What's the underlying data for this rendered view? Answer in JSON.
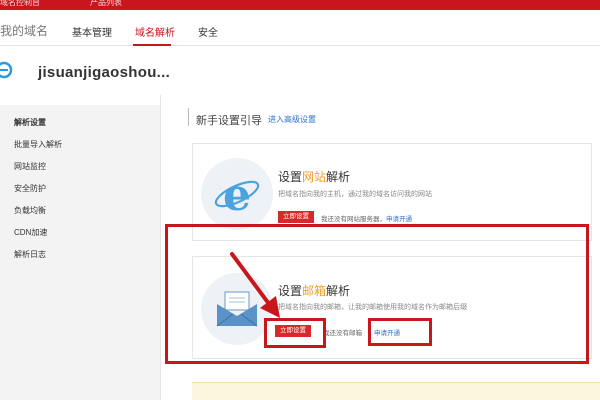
{
  "topbar": {
    "crumb_left": "域名控制台",
    "crumb_right": "产品列表"
  },
  "nav": {
    "title": "我的域名",
    "tabs": [
      {
        "label": "基本管理"
      },
      {
        "label": "域名解析"
      },
      {
        "label": "安全"
      }
    ],
    "active_tab": 1
  },
  "domain": {
    "name": "jisuanjigaoshou..."
  },
  "sidebar": {
    "items": [
      {
        "label": "解析设置"
      },
      {
        "label": "批量导入解析"
      },
      {
        "label": "网站监控"
      },
      {
        "label": "安全防护"
      },
      {
        "label": "负载均衡"
      },
      {
        "label": "CDN加速"
      },
      {
        "label": "解析日志"
      }
    ]
  },
  "guide": {
    "title": "新手设置引导",
    "link": "进入高级设置"
  },
  "cards": [
    {
      "title_prefix": "设置",
      "title_highlight": "网站",
      "title_suffix": "解析",
      "desc": "把域名指向我的主机，通过我的域名访问我的网站",
      "button": "立即设置",
      "note_text": "我还没有网站服务器，",
      "note_link": "申请开通"
    },
    {
      "title_prefix": "设置",
      "title_highlight": "邮箱",
      "title_suffix": "解析",
      "desc": "把域名指向我的邮箱，让我的邮箱使用我的域名作为邮箱后缀",
      "button": "立即设置",
      "note_text": "我还没有邮箱",
      "note_link": "申请开通"
    }
  ],
  "colors": {
    "brand_red": "#c9151e",
    "highlight": "#f0a024",
    "link": "#2a73c9",
    "annotation": "#c8161d"
  }
}
